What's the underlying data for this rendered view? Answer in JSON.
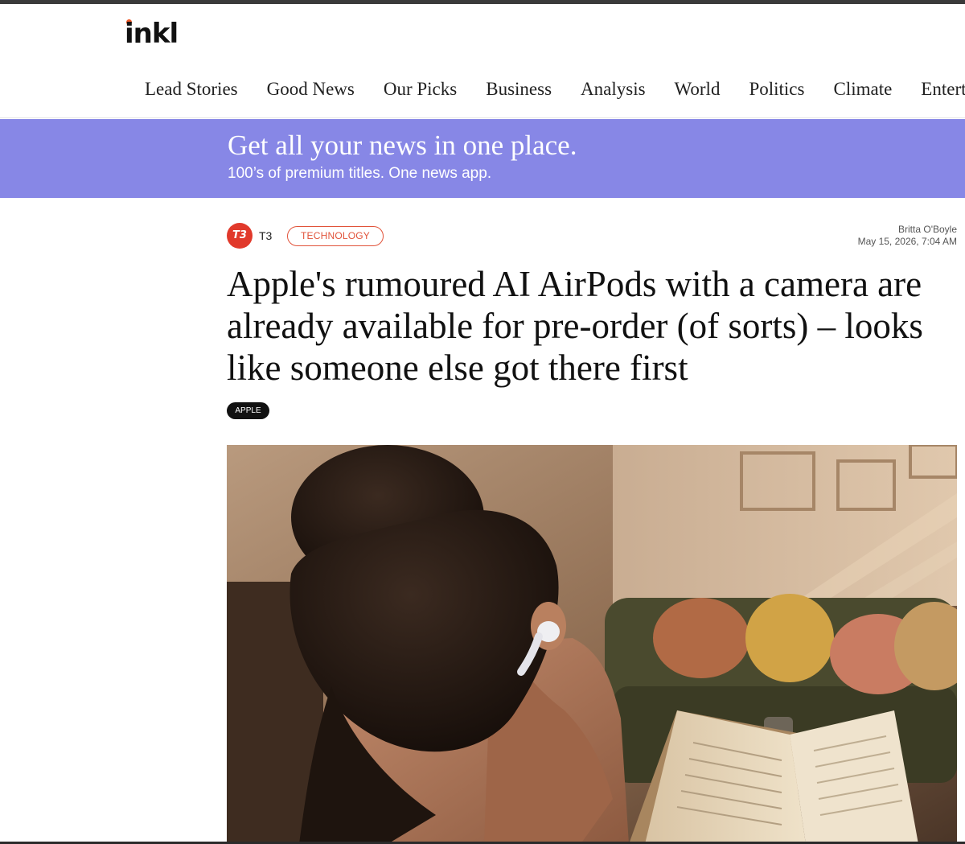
{
  "site": {
    "logo_text": "inkl"
  },
  "nav": {
    "items": [
      {
        "label": "Lead Stories"
      },
      {
        "label": "Good News"
      },
      {
        "label": "Our Picks"
      },
      {
        "label": "Business"
      },
      {
        "label": "Analysis"
      },
      {
        "label": "World"
      },
      {
        "label": "Politics"
      },
      {
        "label": "Climate"
      },
      {
        "label": "Entertainment"
      }
    ]
  },
  "promo": {
    "title": "Get all your news in one place.",
    "subtitle": "100’s of premium titles. One news app."
  },
  "article": {
    "source_logo": "T3",
    "source_name": "T3",
    "category": "TECHNOLOGY",
    "author": "Britta O'Boyle",
    "date": "May 15, 2026, 7:04 AM",
    "headline": "Apple's rumoured AI AirPods with a camera are already available for pre-order (of sorts) – looks like someone else got there first",
    "tag": "APPLE"
  },
  "colors": {
    "promo_bg": "#8787e6",
    "accent": "#e1533a",
    "logo_dot": "#f05a28"
  }
}
